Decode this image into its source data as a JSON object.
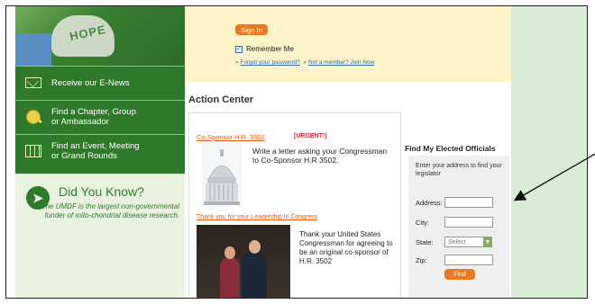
{
  "sidebar": {
    "photo_text": "HOPE",
    "items": [
      {
        "label_line1": "Receive our E-News",
        "label_line2": "",
        "icon": "envelope-icon"
      },
      {
        "label_line1": "Find a Chapter, Group",
        "label_line2": "or Ambassador",
        "icon": "globe-search-icon"
      },
      {
        "label_line1": "Find an Event, Meeting",
        "label_line2": "or Grand Rounds",
        "icon": "calendar-icon"
      }
    ],
    "did_you_know": {
      "title": "Did You Know?",
      "body": "The UMDF is the largest non-governmental funder of mito-chondrial disease research."
    }
  },
  "signin": {
    "button_label": "Sign In",
    "remember_label": "Remember Me",
    "forgot_link": "Forgot your password?",
    "member_link": "Not a member? Join Now"
  },
  "action_center": {
    "title": "Action Center",
    "cosponsor_link": "Co-Sponsor H.R. 3502",
    "urgent_label": "[URGENT!]",
    "cosponsor_text": "Write a letter asking your Congressman to Co-Sponsor H.R 3502.",
    "thanks_link": "Thank you for your Leadership in Congress",
    "thanks_text": "Thank your United States Congressman for agreeing to be an original co-sponsor of H.R. 3502"
  },
  "officials": {
    "title": "Find My Elected Officials",
    "intro": "Enter your address to find your legislator",
    "address_label": "Address:",
    "city_label": "City:",
    "state_label": "State:",
    "state_value": "Select",
    "zip_label": "Zip:",
    "find_label": "Find"
  },
  "colors": {
    "sidebar_green": "#2f7a2a",
    "accent_orange": "#e87a22",
    "link_blue": "#2c6db0"
  }
}
